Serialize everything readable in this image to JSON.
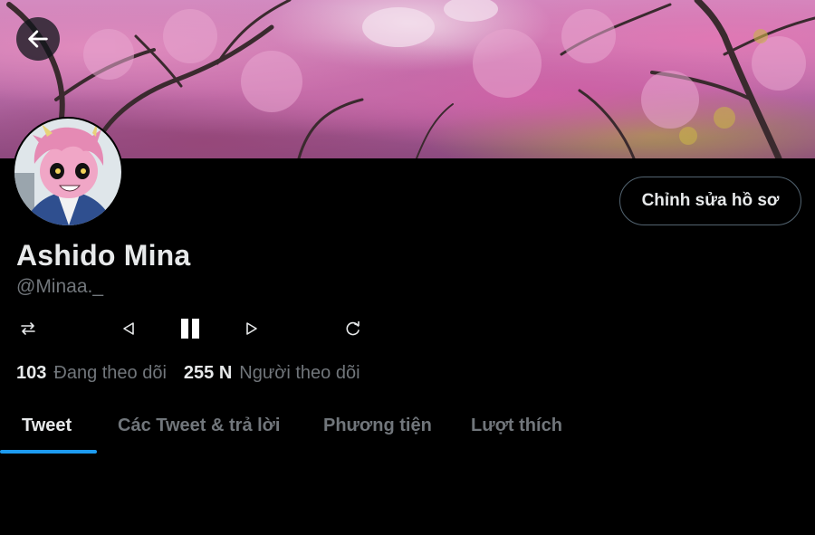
{
  "header": {
    "back_label": "Back"
  },
  "profile": {
    "display_name": "Ashido Mina",
    "handle": "@Minaa._",
    "edit_button_label": "Chỉnh sửa hồ sơ"
  },
  "media_controls": [
    {
      "name": "shuffle-icon",
      "glyph": "⇆"
    },
    {
      "name": "previous-icon",
      "glyph": "◁"
    },
    {
      "name": "pause-icon",
      "glyph": "▮▮"
    },
    {
      "name": "next-icon",
      "glyph": "▷"
    },
    {
      "name": "repeat-icon",
      "glyph": "↻"
    }
  ],
  "stats": {
    "following_count": "103",
    "following_label": "Đang theo dõi",
    "followers_count": "255 N",
    "followers_label": "Người theo dõi"
  },
  "tabs": [
    {
      "label": "Tweet",
      "active": true
    },
    {
      "label": "Các Tweet & trả lời",
      "active": false
    },
    {
      "label": "Phương tiện",
      "active": false
    },
    {
      "label": "Lượt thích",
      "active": false
    }
  ],
  "colors": {
    "background": "#000000",
    "accent": "#1d9bf0",
    "muted_text": "#71767b",
    "primary_text": "#e7e9ea",
    "button_border": "#536471"
  }
}
